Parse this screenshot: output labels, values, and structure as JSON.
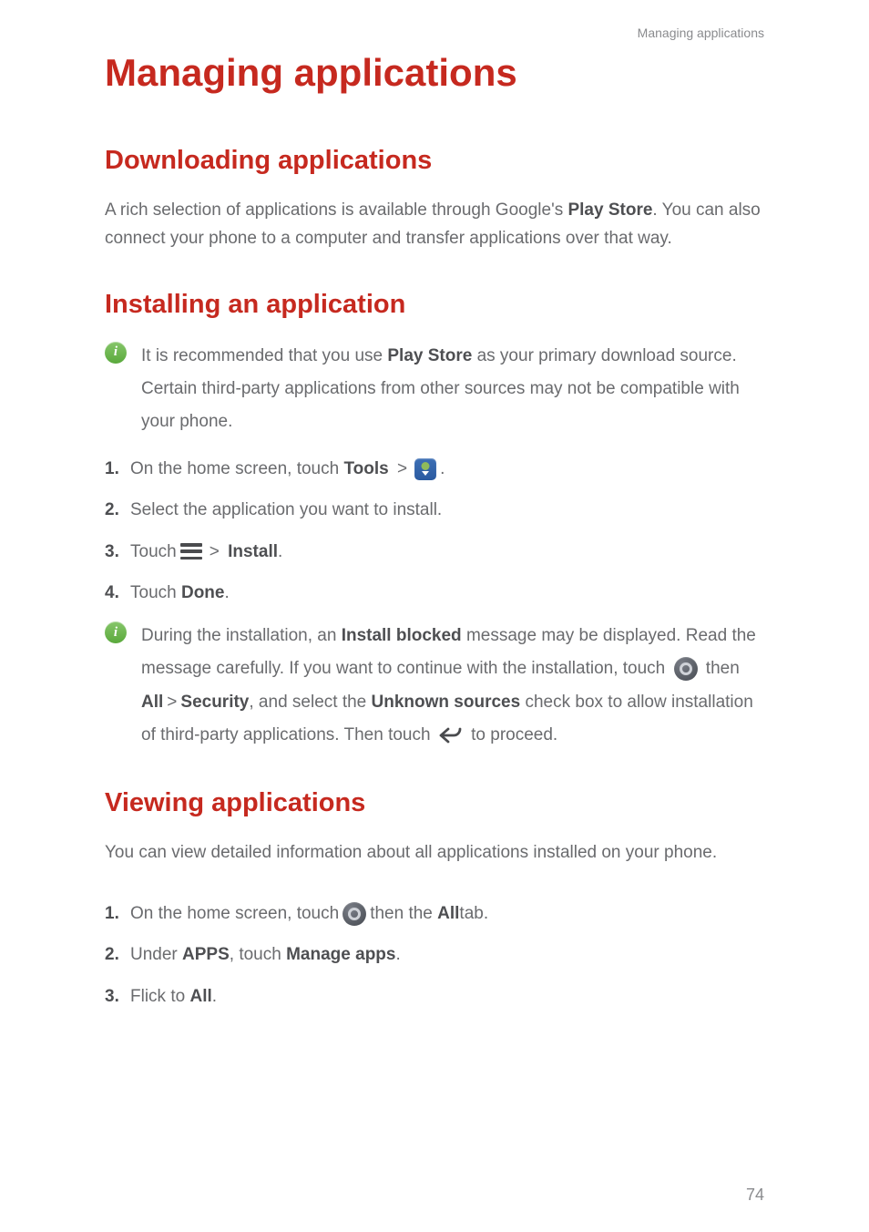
{
  "running_header": "Managing applications",
  "main_title": "Managing applications",
  "page_number": "74",
  "sections": {
    "downloading": {
      "title": "Downloading applications",
      "para_parts": {
        "p1": "A rich selection of applications is available through Google's ",
        "play_store": "Play Store",
        "p2": ". You can also connect your phone to a computer and transfer applications over that way."
      }
    },
    "installing": {
      "title": "Installing an application",
      "info1": {
        "p1": "It is recommended that you use ",
        "play_store": "Play Store",
        "p2": " as your primary download source. Certain third-party applications from other sources may not be compatible with your phone."
      },
      "steps": {
        "s1_a": "On the home screen, touch ",
        "s1_tools": "Tools",
        "s1_b": " .",
        "s2": "Select the application you want to install.",
        "s3_a": "Touch ",
        "s3_install": "Install",
        "s3_b": ".",
        "s4_a": "Touch ",
        "s4_done": "Done",
        "s4_b": "."
      },
      "info2": {
        "p1": "During the installation, an ",
        "install_blocked": "Install blocked",
        "p2": " message may be displayed. Read the message carefully. If you want to continue with the installation, touch ",
        "p3": " then ",
        "all": "All",
        "security": "Security",
        "p4": ", and select the ",
        "unknown_sources": "Unknown sources",
        "p5": " check box to allow installation of third-party applications. Then touch ",
        "p6": " to proceed."
      }
    },
    "viewing": {
      "title": "Viewing applications",
      "para": "You can view detailed information about all applications installed on your phone.",
      "steps": {
        "s1_a": "On the home screen, touch ",
        "s1_b": " then the ",
        "s1_all": "All",
        "s1_c": " tab.",
        "s2_a": "Under ",
        "s2_apps": "APPS",
        "s2_b": ", touch ",
        "s2_manage": "Manage apps",
        "s2_c": ".",
        "s3_a": "Flick to ",
        "s3_all": "All",
        "s3_b": "."
      }
    }
  },
  "symbols": {
    "gt": ">"
  }
}
